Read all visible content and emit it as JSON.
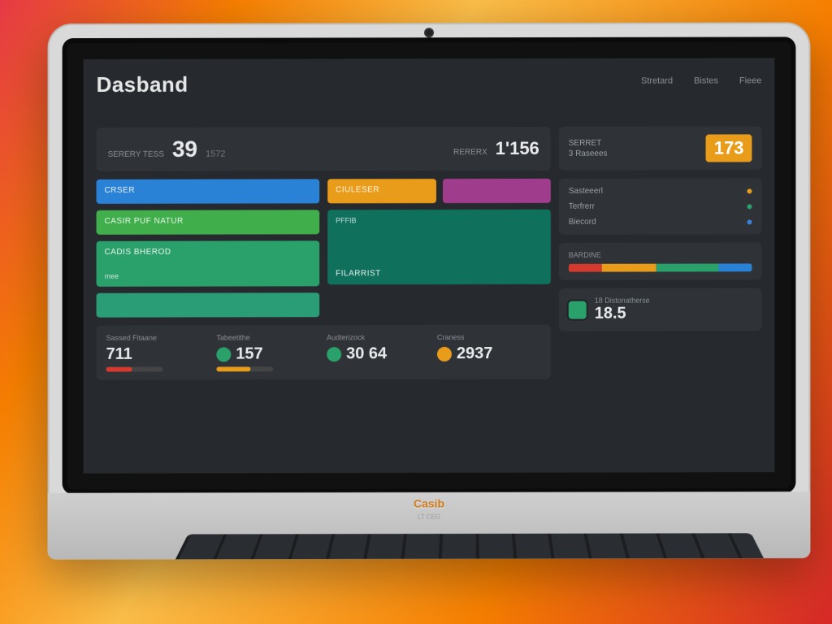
{
  "title": "Dasband",
  "nav": [
    "Stretard",
    "Bistes",
    "Fieee"
  ],
  "stat": {
    "label_top": "SERERY TESS",
    "big": "39",
    "small": "1572",
    "right_label": "RERERX",
    "right_value": "1'156"
  },
  "left_tiles": {
    "blue": {
      "label": "CRSER"
    },
    "green1": {
      "label": "Casir Puf Natur"
    },
    "green2": {
      "label": "Cadis Bherod",
      "sub": "mee"
    },
    "green3": {
      "label": ""
    }
  },
  "center_tiles": {
    "orange": {
      "label": "CIULESER"
    },
    "purple": {
      "label": ""
    },
    "teal": {
      "label": "FILARRIST",
      "sub": "PFFIB"
    }
  },
  "strip": [
    {
      "label": "Sassed Fitaane",
      "value": "711",
      "bar": 45,
      "color": "#d63a2f"
    },
    {
      "label": "Tabeetithe",
      "value": "157",
      "dot": "#2aa06b",
      "bar": 60,
      "color": "#e89c1a"
    },
    {
      "label": "Audterizock",
      "value": "30 64",
      "dot": "#2aa06b"
    },
    {
      "label": "Craness",
      "value": "2937",
      "dot": "#e89c1a"
    }
  ],
  "right_top": {
    "label1": "SERRET",
    "label2": "3 Raseees",
    "value": "173"
  },
  "right_list": [
    {
      "label": "Sasteeerl",
      "tag": "#e89c1a"
    },
    {
      "label": "Terfrerr",
      "tag": "#2aa06b"
    },
    {
      "label": "Biecord",
      "tag": "#3a82d6"
    }
  ],
  "pct_label": "BARDINE",
  "pct_segments": [
    {
      "color": "#d63a2f",
      "w": 18
    },
    {
      "color": "#e89c1a",
      "w": 30
    },
    {
      "color": "#2aa06b",
      "w": 34
    },
    {
      "color": "#2a82d6",
      "w": 18
    }
  ],
  "right_metric": {
    "label": "18 Distonatherse",
    "value": "18.5"
  },
  "brand": "Casib",
  "brand2": "LT CEG"
}
